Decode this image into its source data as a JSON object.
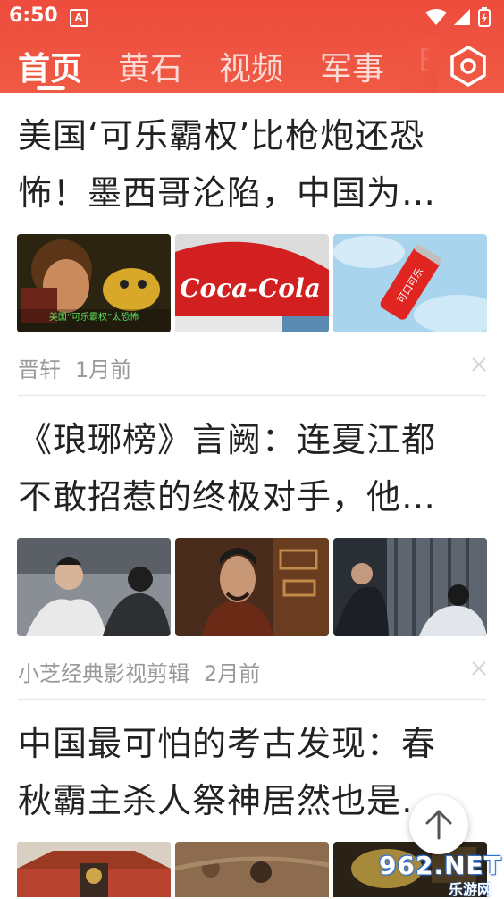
{
  "status_bar": {
    "time": "6:50",
    "notification_icon": "A"
  },
  "tabs": [
    {
      "label": "首页",
      "active": true
    },
    {
      "label": "黄石",
      "active": false
    },
    {
      "label": "视频",
      "active": false
    },
    {
      "label": "军事",
      "active": false
    },
    {
      "label": "E",
      "active": false
    }
  ],
  "settings_icon": "gear-hexagon-icon",
  "colors": {
    "accent": "#ee4c3d",
    "text": "#222222",
    "meta": "#999999"
  },
  "articles": [
    {
      "title_line1": "美国‘可乐霸权’比枪炮还恐",
      "title_line2": "怖！墨西哥沦陷，中国为…",
      "thumb_caption": "美国“可乐霸权”太恐怖",
      "thumb2_text": "Coca-Cola",
      "thumb3_text": "可口可乐",
      "author": "晋轩",
      "time": "1月前"
    },
    {
      "title_line1": "《琅琊榜》言阙：连夏江都",
      "title_line2": "不敢招惹的终极对手，他…",
      "author": "小芝经典影视剪辑",
      "time": "2月前"
    },
    {
      "title_line1": "中国最可怕的考古发现：春",
      "title_line2": "秋霸主杀人祭神居然也是…"
    }
  ],
  "watermark": {
    "text": "962.NET",
    "sub": "乐游网"
  }
}
